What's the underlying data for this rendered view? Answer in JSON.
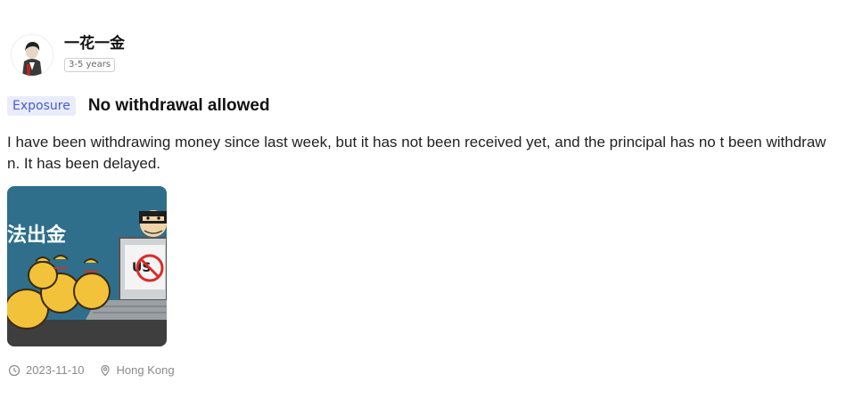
{
  "author": {
    "name": "一花一金",
    "experience": "3-5 years"
  },
  "post": {
    "tag": "Exposure",
    "title": "No withdrawal allowed",
    "body": "I have been withdrawing money since last week, but it has not been received yet, and the principal has no t been withdrawn. It has been delayed.",
    "image_caption_text": "法出金",
    "date": "2023-11-10",
    "location": "Hong Kong"
  },
  "icons": {
    "date": "clock-icon",
    "location": "location-pin-icon"
  },
  "colors": {
    "tag_bg": "#e9ecfb",
    "tag_text": "#4a5bd4",
    "meta_text": "#8a8a8a",
    "image_bg": "#2f6f8c",
    "money_bag": "#f2c23a"
  }
}
